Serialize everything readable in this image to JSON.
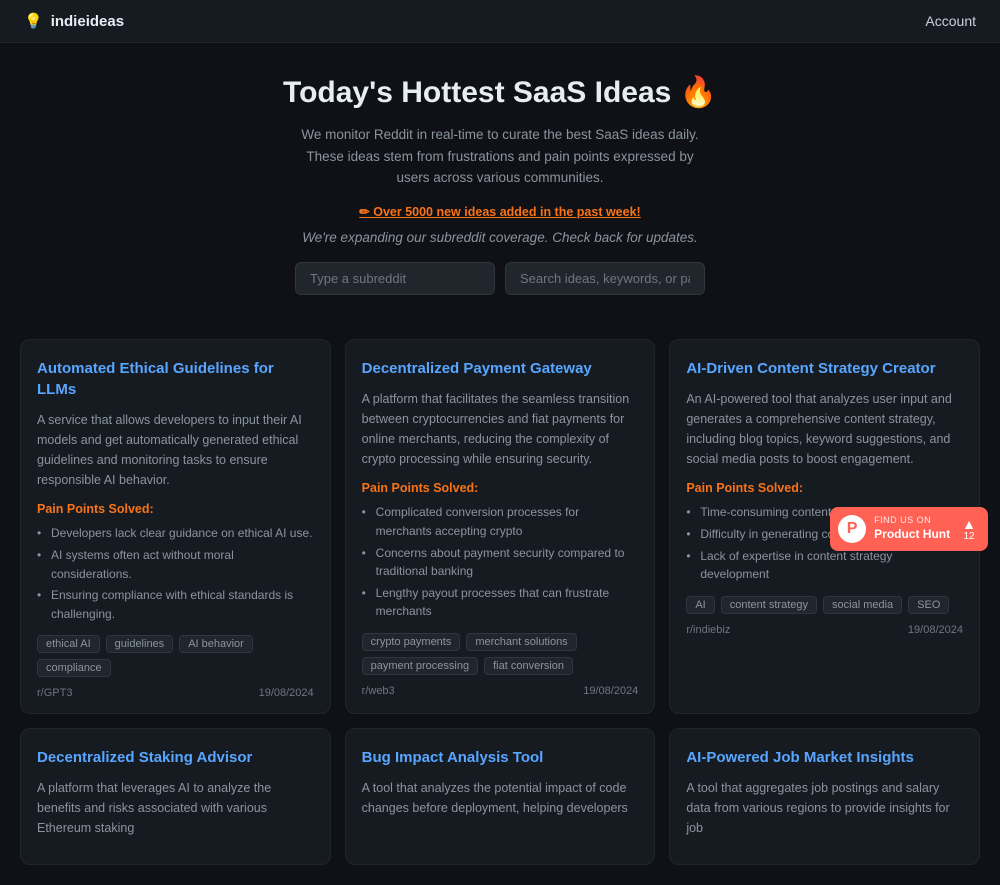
{
  "navbar": {
    "brand": "indieideas",
    "brand_icon": "💡",
    "account_label": "Account"
  },
  "hero": {
    "title": "Today's Hottest SaaS Ideas 🔥",
    "subtitle": "We monitor Reddit in real-time to curate the best SaaS ideas daily. These ideas stem from frustrations and pain points expressed by users across various communities.",
    "badge_text": "✏ Over 5000 new ideas added in the past week!",
    "sub_text": "We're expanding our subreddit coverage. Check back for updates.",
    "search_placeholder": "Type a subreddit",
    "ideas_placeholder": "Search ideas, keywords, or pain poi"
  },
  "cards": [
    {
      "id": 1,
      "title": "Automated Ethical Guidelines for LLMs",
      "desc": "A service that allows developers to input their AI models and get automatically generated ethical guidelines and monitoring tasks to ensure responsible AI behavior.",
      "pain_label": "Pain Points Solved:",
      "pain_points": [
        "Developers lack clear guidance on ethical AI use.",
        "AI systems often act without moral considerations.",
        "Ensuring compliance with ethical standards is challenging."
      ],
      "tags": [
        "ethical AI",
        "guidelines",
        "AI behavior",
        "compliance"
      ],
      "source": "r/GPT3",
      "date": "19/08/2024"
    },
    {
      "id": 2,
      "title": "Decentralized Payment Gateway",
      "desc": "A platform that facilitates the seamless transition between cryptocurrencies and fiat payments for online merchants, reducing the complexity of crypto processing while ensuring security.",
      "pain_label": "Pain Points Solved:",
      "pain_points": [
        "Complicated conversion processes for merchants accepting crypto",
        "Concerns about payment security compared to traditional banking",
        "Lengthy payout processes that can frustrate merchants"
      ],
      "tags": [
        "crypto payments",
        "merchant solutions",
        "payment processing",
        "fiat conversion"
      ],
      "source": "r/web3",
      "date": "19/08/2024"
    },
    {
      "id": 3,
      "title": "AI-Driven Content Strategy Creator",
      "desc": "An AI-powered tool that analyzes user input and generates a comprehensive content strategy, including blog topics, keyword suggestions, and social media posts to boost engagement.",
      "pain_label": "Pain Points Solved:",
      "pain_points": [
        "Time-consuming content planning process",
        "Difficulty in generating consistent content ideas",
        "Lack of expertise in content strategy development"
      ],
      "tags": [
        "AI",
        "content strategy",
        "social media",
        "SEO"
      ],
      "source": "r/indiebiz",
      "date": "19/08/2024"
    },
    {
      "id": 4,
      "title": "Decentralized Staking Advisor",
      "desc": "A platform that leverages AI to analyze the benefits and risks associated with various Ethereum staking",
      "pain_label": "",
      "pain_points": [],
      "tags": [],
      "source": "",
      "date": ""
    },
    {
      "id": 5,
      "title": "Bug Impact Analysis Tool",
      "desc": "A tool that analyzes the potential impact of code changes before deployment, helping developers",
      "pain_label": "",
      "pain_points": [],
      "tags": [],
      "source": "",
      "date": ""
    },
    {
      "id": 6,
      "title": "AI-Powered Job Market Insights",
      "desc": "A tool that aggregates job postings and salary data from various regions to provide insights for job",
      "pain_label": "",
      "pain_points": [],
      "tags": [],
      "source": "",
      "date": ""
    }
  ],
  "product_hunt": {
    "find_us": "FIND US ON",
    "name": "Product Hunt",
    "count": "12",
    "arrow": "▲"
  }
}
